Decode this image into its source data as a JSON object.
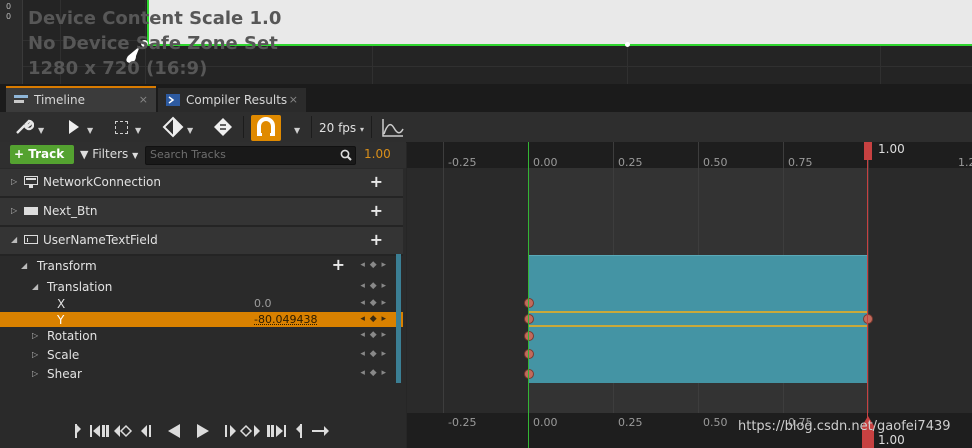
{
  "designer": {
    "ruler_top": "0",
    "ruler_bottom": "0",
    "line1": "Device Content Scale 1.0",
    "line2": "No Device Safe Zone Set",
    "line3": "1280 x 720 (16:9)"
  },
  "tabs": [
    {
      "label": "Timeline",
      "close": "×"
    },
    {
      "label": "Compiler Results",
      "close": "×"
    }
  ],
  "toolbar": {
    "fps": "20 fps",
    "fps_caret": "▾"
  },
  "filterbar": {
    "add_track": "+ Track",
    "filters": "Filters",
    "search_placeholder": "Search Tracks",
    "current_time": "1.00"
  },
  "tracks": [
    {
      "label": "NetworkConnection",
      "add": "+"
    },
    {
      "label": "Next_Btn",
      "add": "+"
    },
    {
      "label": "UserNameTextField",
      "add": "+"
    }
  ],
  "properties": {
    "transform": "Transform",
    "transform_add": "+",
    "translation": "Translation",
    "x_label": "X",
    "x_value": "0.0",
    "y_label": "Y",
    "y_value": "-80.049438",
    "rotation": "Rotation",
    "scale": "Scale",
    "shear": "Shear",
    "key_controls": "◂ ◆ ▸"
  },
  "timeline": {
    "ticks": [
      "-0.25",
      "0.00",
      "0.25",
      "0.50",
      "0.75",
      "1.00"
    ],
    "end_label": "1.00",
    "cut_label": "1.2"
  },
  "watermark": "https://blog.csdn.net/gaofei7439"
}
